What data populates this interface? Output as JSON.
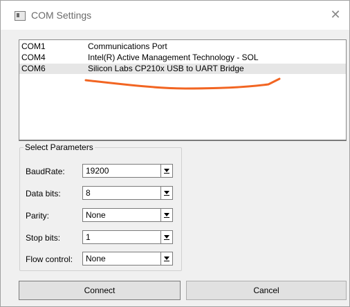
{
  "window": {
    "title": "COM Settings",
    "close_symbol": "✕"
  },
  "ports": [
    {
      "port": "COM1",
      "description": "Communications Port"
    },
    {
      "port": "COM4",
      "description": "Intel(R) Active Management Technology - SOL"
    },
    {
      "port": "COM6",
      "description": "Silicon Labs CP210x USB to UART Bridge",
      "selected": true
    }
  ],
  "annotation": {
    "color": "#f26522"
  },
  "params": {
    "group_title": "Select Parameters",
    "baud": {
      "label": "BaudRate:",
      "value": "19200"
    },
    "databits": {
      "label": "Data bits:",
      "value": "8"
    },
    "parity": {
      "label": "Parity:",
      "value": "None"
    },
    "stopbits": {
      "label": "Stop bits:",
      "value": "1"
    },
    "flow": {
      "label": "Flow control:",
      "value": "None"
    }
  },
  "buttons": {
    "connect": "Connect",
    "cancel": "Cancel"
  }
}
